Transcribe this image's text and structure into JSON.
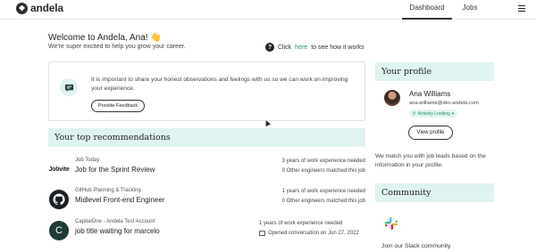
{
  "nav": {
    "logo_text": "andela",
    "tabs": [
      {
        "label": "Dashboard",
        "active": true
      },
      {
        "label": "Jobs",
        "active": false
      }
    ],
    "menu_icon": "hamburger-icon"
  },
  "welcome": {
    "title": "Welcome to Andela, Ana! 👋",
    "subtitle": "We're super excited to help you grow your career.",
    "help_prefix": "Click",
    "help_link": "here",
    "help_suffix": "to see how it works"
  },
  "feedback": {
    "text": "It is important to share your honest observations and feelings with us so we can work on improving your experience.",
    "button": "Provide Feedback"
  },
  "recommendations": {
    "header": "Your top recommendations",
    "items": [
      {
        "logo_text": "Jobvite",
        "company": "Job Today",
        "title": "Job for the Sprint Review",
        "meta1": "3 years of work experience needed",
        "meta2": "0 Other engineers matched this job"
      },
      {
        "company": "GitHub Planning & Tracking",
        "title": "Midlevel Front-end Engineer",
        "meta1": "1 years of work experience needed",
        "meta2": "0 Other engineers matched this job"
      },
      {
        "logo_text": "C",
        "company": "CapitalOne - Andela Test Account",
        "title": "job title waiting for marcelo",
        "meta1": "1 years of work experience needed",
        "meta2": "Opened conversation on Jun 27, 2022"
      }
    ]
  },
  "profile": {
    "header": "Your profile",
    "name": "Ana Williams",
    "email": "ana.williams@dev.andela.com",
    "status": "Actively Looking",
    "view_button": "View profile",
    "match_text": "We match you with job leads based on the information in your profile."
  },
  "community": {
    "header": "Community",
    "slack_text": "Join our Slack community"
  },
  "colors": {
    "accent_bg": "#dff3f0",
    "link": "#1f8f6a"
  }
}
